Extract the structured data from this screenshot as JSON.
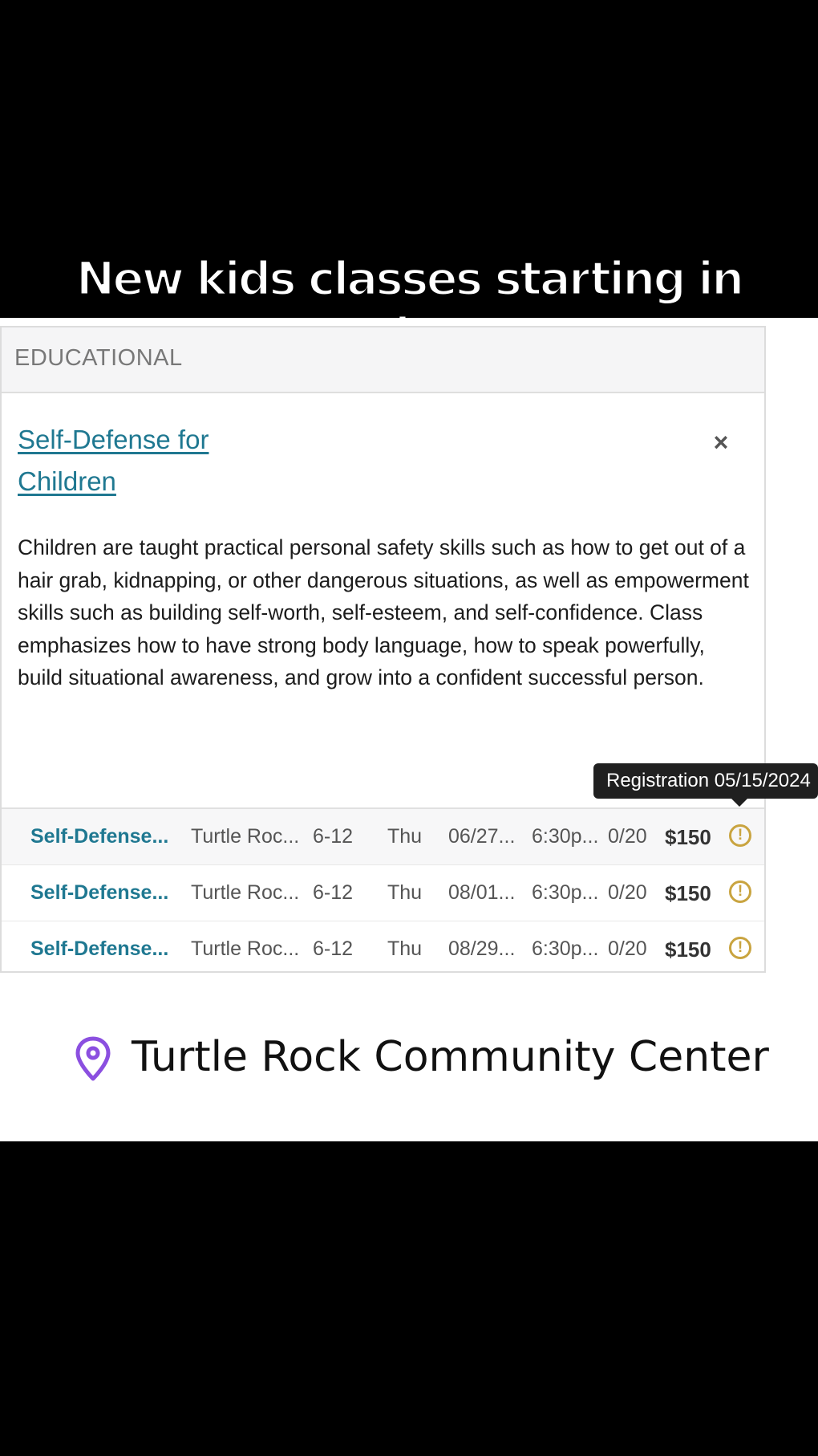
{
  "caption": "New kids classes starting in Irvine!",
  "card": {
    "category": "EDUCATIONAL",
    "title": "Self-Defense for Children",
    "close_label": "×",
    "description": "Children are taught practical personal safety skills such as how to get out of a hair grab, kidnapping, or other dangerous situations, as well as empowerment skills such as building self-worth, self-esteem, and self-confidence. Class emphasizes how to have strong body language, how to speak powerfully, build situational awareness, and grow into a confident successful person."
  },
  "tooltip": "Registration 05/15/2024",
  "sessions": [
    {
      "name": "Self-Defense...",
      "location": "Turtle Roc...",
      "ages": "6-12",
      "day": "Thu",
      "date": "06/27...",
      "time": "6:30p...",
      "capacity": "0/20",
      "price": "$150",
      "alert": "!"
    },
    {
      "name": "Self-Defense...",
      "location": "Turtle Roc...",
      "ages": "6-12",
      "day": "Thu",
      "date": "08/01...",
      "time": "6:30p...",
      "capacity": "0/20",
      "price": "$150",
      "alert": "!"
    },
    {
      "name": "Self-Defense...",
      "location": "Turtle Roc...",
      "ages": "6-12",
      "day": "Thu",
      "date": "08/29...",
      "time": "6:30p...",
      "capacity": "0/20",
      "price": "$150",
      "alert": "!"
    }
  ],
  "location_badge": {
    "icon": "map-pin-icon",
    "name": "Turtle Rock Community Center",
    "pin_color": "#8b4fe0"
  },
  "colors": {
    "link": "#1f7891",
    "alert": "#c9a440"
  }
}
